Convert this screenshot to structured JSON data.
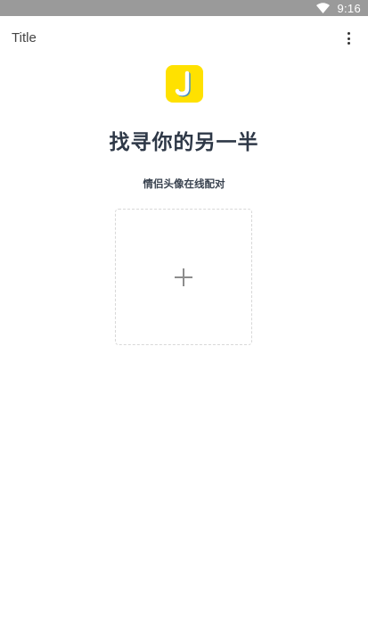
{
  "status_bar": {
    "time": "9:16",
    "icons": [
      "wifi-icon"
    ]
  },
  "app_bar": {
    "title": "Title",
    "menu_icon": "more-vert-icon"
  },
  "logo": {
    "letter": "J",
    "bg_color": "#ffe100"
  },
  "main": {
    "headline": "找寻你的另一半",
    "subtitle": "情侣头像在线配对",
    "upload_icon": "plus-icon"
  },
  "colors": {
    "status_bar": "#9a9a9a",
    "headline": "#2e3847",
    "upload_border": "#d8d8d8"
  }
}
